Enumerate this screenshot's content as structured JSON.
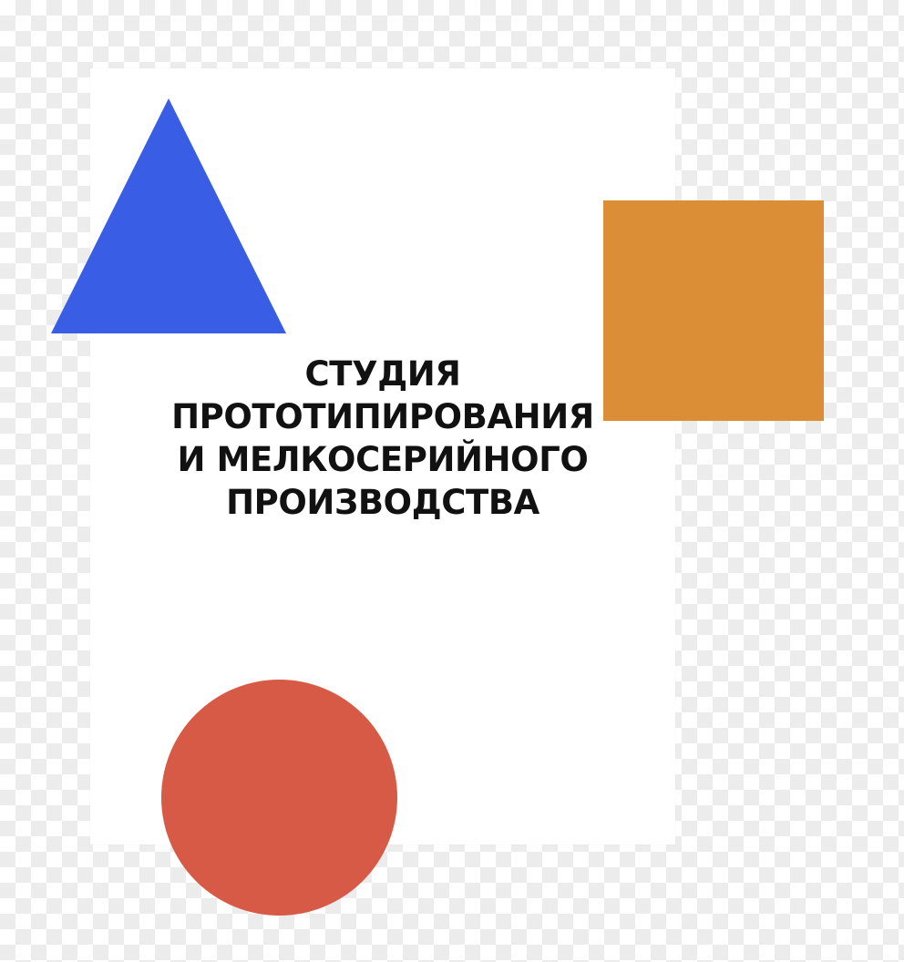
{
  "title_lines": [
    "СТУДИЯ",
    "ПРОТОТИПИРОВАНИЯ",
    "И МЕЛКОСЕРИЙНОГО",
    "ПРОИЗВОДСТВА"
  ],
  "colors": {
    "triangle": "#3A5DE6",
    "square": "#DB8E36",
    "circle": "#D75A46",
    "panel": "#FFFFFF",
    "text": "#111111"
  },
  "shapes": {
    "triangle_name": "blue-triangle",
    "square_name": "orange-square",
    "circle_name": "red-circle"
  }
}
